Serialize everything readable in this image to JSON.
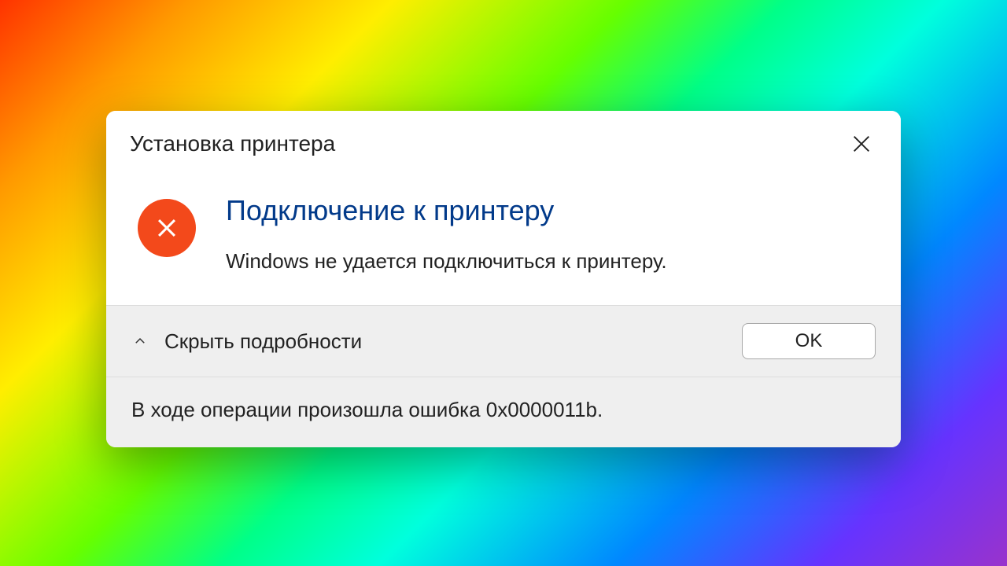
{
  "dialog": {
    "title": "Установка принтера",
    "heading": "Подключение к принтеру",
    "message": "Windows не удается подключиться к принтеру.",
    "details_toggle_label": "Скрыть подробности",
    "ok_label": "OK",
    "details_text": "В ходе операции произошла ошибка 0x0000011b."
  }
}
